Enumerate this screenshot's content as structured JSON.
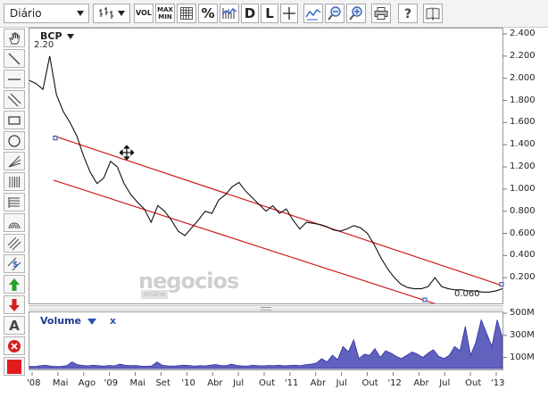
{
  "toolbar": {
    "period_value": "Diário",
    "volume_label": "VOL",
    "maxmin_label_1": "MAX",
    "maxmin_label_2": "MIN",
    "percent_label": "%",
    "d_label": "D",
    "l_label": "L",
    "icons": [
      "bars-chart-icon",
      "grid-icon",
      "percent-icon",
      "lines-chart-icon",
      "crosshair-icon",
      "indicator-icon",
      "zoom-out-icon",
      "zoom-in-icon",
      "print-icon",
      "help-icon",
      "book-icon"
    ]
  },
  "sidebar": {
    "tools": [
      "hand-icon",
      "diagonal-line-icon",
      "horizontal-line-icon",
      "parallel-lines-icon",
      "rectangle-icon",
      "circle-icon",
      "fan-icon",
      "fibonacci-icon",
      "levels-icon",
      "arc-icon",
      "channel-icon",
      "dollar-icon",
      "arrow-up-icon",
      "arrow-down-icon",
      "text-icon",
      "delete-icon",
      "color-picker-icon"
    ],
    "text_tool_label": "A",
    "color": "#e11b1b"
  },
  "chart": {
    "symbol": "BCP",
    "start_value_label": "2.20",
    "last_value_label": "0.060",
    "watermark": "negocios",
    "watermark_sub": "online",
    "price_color": "#111111",
    "channel_color": "#d01c1c"
  },
  "volume": {
    "title": "Volume",
    "close": "x",
    "color": "#2c2ca8"
  },
  "chart_data": {
    "type": "line",
    "ylim": [
      0,
      2.4
    ],
    "y_ticks": [
      "2.400",
      "2.200",
      "2.000",
      "1.800",
      "1.600",
      "1.400",
      "1.200",
      "1.000",
      "0.800",
      "0.600",
      "0.400",
      "0.200"
    ],
    "x_ticks": [
      "'08",
      "Mai",
      "Ago",
      "'09",
      "Mai",
      "Set",
      "'10",
      "Abr",
      "Jul",
      "Out",
      "'11",
      "Abr",
      "Jul",
      "Out",
      "'12",
      "Abr",
      "Jul",
      "Out",
      "'13"
    ],
    "series": [
      {
        "name": "BCP",
        "values": [
          1.98,
          1.95,
          1.9,
          2.2,
          1.85,
          1.7,
          1.6,
          1.48,
          1.3,
          1.15,
          1.05,
          1.1,
          1.25,
          1.2,
          1.05,
          0.95,
          0.88,
          0.82,
          0.7,
          0.85,
          0.8,
          0.72,
          0.62,
          0.58,
          0.65,
          0.72,
          0.8,
          0.78,
          0.9,
          0.95,
          1.02,
          1.06,
          0.98,
          0.92,
          0.86,
          0.8,
          0.85,
          0.78,
          0.82,
          0.72,
          0.64,
          0.7,
          0.69,
          0.68,
          0.66,
          0.63,
          0.62,
          0.64,
          0.67,
          0.65,
          0.6,
          0.5,
          0.38,
          0.28,
          0.2,
          0.14,
          0.11,
          0.1,
          0.1,
          0.12,
          0.2,
          0.12,
          0.1,
          0.09,
          0.09,
          0.08,
          0.08,
          0.07,
          0.07,
          0.08,
          0.1
        ]
      }
    ],
    "volume_ticks": [
      "500M",
      "300M",
      "100M"
    ],
    "volume_ylim": [
      0,
      500
    ],
    "volume_values": [
      20,
      18,
      25,
      30,
      22,
      18,
      20,
      26,
      60,
      35,
      28,
      24,
      30,
      26,
      22,
      28,
      24,
      40,
      30,
      26,
      28,
      22,
      20,
      24,
      60,
      30,
      24,
      22,
      26,
      30,
      28,
      22,
      26,
      24,
      30,
      36,
      28,
      26,
      40,
      28,
      24,
      22,
      30,
      26,
      24,
      28,
      26,
      30,
      24,
      28,
      30,
      26,
      35,
      40,
      50,
      90,
      60,
      120,
      80,
      200,
      150,
      260,
      90,
      130,
      120,
      180,
      100,
      160,
      140,
      110,
      90,
      120,
      150,
      130,
      100,
      140,
      170,
      110,
      90,
      120,
      200,
      160,
      380,
      120,
      240,
      440,
      320,
      200,
      440,
      280
    ]
  }
}
